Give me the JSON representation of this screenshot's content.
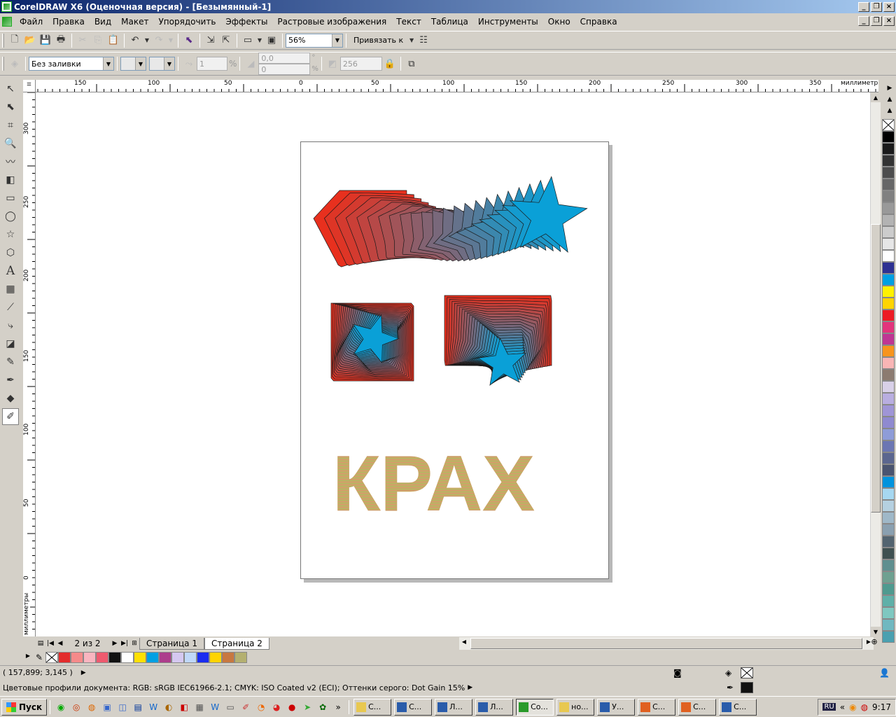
{
  "window": {
    "title": "CorelDRAW X6 (Оценочная версия) - [Безымянный-1]"
  },
  "menu": [
    "Файл",
    "Правка",
    "Вид",
    "Макет",
    "Упорядочить",
    "Эффекты",
    "Растровые изображения",
    "Текст",
    "Таблица",
    "Инструменты",
    "Окно",
    "Справка"
  ],
  "toolbar": {
    "zoom": "56%",
    "snap_label": "Привязать к"
  },
  "property_bar": {
    "fill": "Без заливки",
    "count": "1",
    "pct": "%",
    "offset_x": "0,0",
    "offset_y": "0",
    "degree": "°",
    "pct2": "%",
    "steps": "256"
  },
  "ruler": {
    "units": "миллиметры",
    "h_ticks": [
      "150",
      "100",
      "50",
      "0",
      "50",
      "100",
      "150",
      "200",
      "250",
      "300",
      "350"
    ],
    "v_ticks": [
      "300",
      "250",
      "200",
      "150",
      "100",
      "50",
      "0"
    ]
  },
  "page_nav": {
    "counter": "2 из 2",
    "tabs": [
      "Страница 1",
      "Страница 2"
    ]
  },
  "canvas": {
    "text_object": "КРАХ"
  },
  "colors": {
    "palette": [
      "#000000",
      "#1a1a1a",
      "#333333",
      "#4d4d4d",
      "#666666",
      "#808080",
      "#999999",
      "#b3b3b3",
      "#cccccc",
      "#e6e6e6",
      "#ffffff",
      "#2e3192",
      "#00a0e3",
      "#fff200",
      "#ffd400",
      "#ed1c24",
      "#e2347c",
      "#bf3594",
      "#f7941d",
      "#f9b5b5",
      "#8c7b70",
      "#d8d0e8",
      "#b9aee0",
      "#9f95d6",
      "#8f8ad0",
      "#8e9cd8",
      "#6b76b3",
      "#5b668f",
      "#4a5470",
      "#0093dd",
      "#a6d7f0",
      "#b5d0e0",
      "#9fb8c8",
      "#8aa0b0",
      "#536470",
      "#3f5050",
      "#5f8f8f",
      "#6fa090",
      "#4f9a8f",
      "#5fb0a8",
      "#7fc8c0",
      "#70b8c0",
      "#4aa0b0"
    ],
    "strip": [
      "#e32c2c",
      "#f58a8a",
      "#f9b5c0",
      "#ee5a6e",
      "#111111",
      "#ffffff",
      "#ffe000",
      "#00a0e3",
      "#ad3d8c",
      "#d5c8f0",
      "#c0d8f8",
      "#1b2cf0",
      "#ffd400",
      "#c87840",
      "#b4b070"
    ]
  },
  "status": {
    "coords": "( 157,899; 3,145 )",
    "profiles": "Цветовые профили документа: RGB: sRGB IEC61966-2.1; CMYK: ISO Coated v2 (ECI); Оттенки серого: Dot Gain 15%"
  },
  "taskbar": {
    "start": "Пуск",
    "tasks": [
      {
        "label": "С...",
        "icon": "folder-icon"
      },
      {
        "label": "С...",
        "icon": "word-icon"
      },
      {
        "label": "Л...",
        "icon": "word-icon"
      },
      {
        "label": "Л...",
        "icon": "word-icon"
      },
      {
        "label": "Co...",
        "icon": "coreldraw-icon"
      },
      {
        "label": "но...",
        "icon": "folder-icon"
      },
      {
        "label": "У...",
        "icon": "word-icon"
      },
      {
        "label": "С...",
        "icon": "firefox-icon"
      },
      {
        "label": "С...",
        "icon": "firefox-icon"
      },
      {
        "label": "С...",
        "icon": "word-icon"
      }
    ],
    "lang": "RU",
    "chevron": "«",
    "clock": "9:17"
  }
}
